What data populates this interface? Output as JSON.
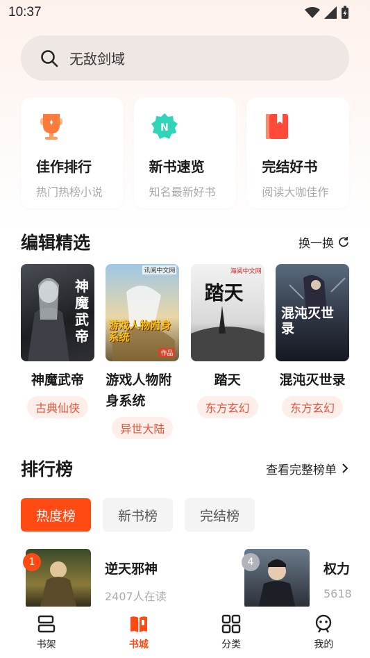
{
  "status_bar": {
    "time": "10:37"
  },
  "search": {
    "text": "无敌剑域"
  },
  "entries": [
    {
      "title": "佳作排行",
      "subtitle": "热门热榜小说",
      "icon": "trophy-icon",
      "color": "#ff7a3d"
    },
    {
      "title": "新书速览",
      "subtitle": "知名最新好书",
      "icon": "new-badge-icon",
      "color": "#2fd4b9"
    },
    {
      "title": "完结好书",
      "subtitle": "阅读大咖佳作",
      "icon": "book-icon",
      "color": "#ff4a3a"
    }
  ],
  "editor_picks": {
    "title": "编辑精选",
    "refresh_label": "换一换",
    "books": [
      {
        "name": "神魔武帝",
        "tag": "古典仙侠",
        "cover_text": "神魔武帝"
      },
      {
        "name": "游戏人物附身系统",
        "tag": "异世大陆",
        "cover_text": "游戏人物附身系统",
        "cover_top": "讯阅中文网",
        "cover_author": "作品"
      },
      {
        "name": "踏天",
        "tag": "东方玄幻",
        "cover_text": "踏天",
        "cover_top": "海阅中文网"
      },
      {
        "name": "混沌灭世录",
        "tag": "东方玄幻",
        "cover_text": "混沌灭世录"
      }
    ]
  },
  "ranking": {
    "title": "排行榜",
    "more_label": "查看完整榜单",
    "tabs": [
      "热度榜",
      "新书榜",
      "完结榜"
    ],
    "active_tab": 0,
    "items": [
      {
        "rank": "1",
        "title": "逆天邪神",
        "reads": "2407人在读"
      },
      {
        "rank": "4",
        "title": "权力",
        "reads": "5618"
      }
    ]
  },
  "bottom_nav": [
    {
      "label": "书架",
      "icon": "bookshelf-icon"
    },
    {
      "label": "书城",
      "icon": "bookstore-icon",
      "active": true
    },
    {
      "label": "分类",
      "icon": "category-icon"
    },
    {
      "label": "我的",
      "icon": "profile-icon"
    }
  ],
  "colors": {
    "accent": "#ff4a14",
    "tag_text": "#e3553a",
    "tag_bg": "#fdeee9"
  }
}
